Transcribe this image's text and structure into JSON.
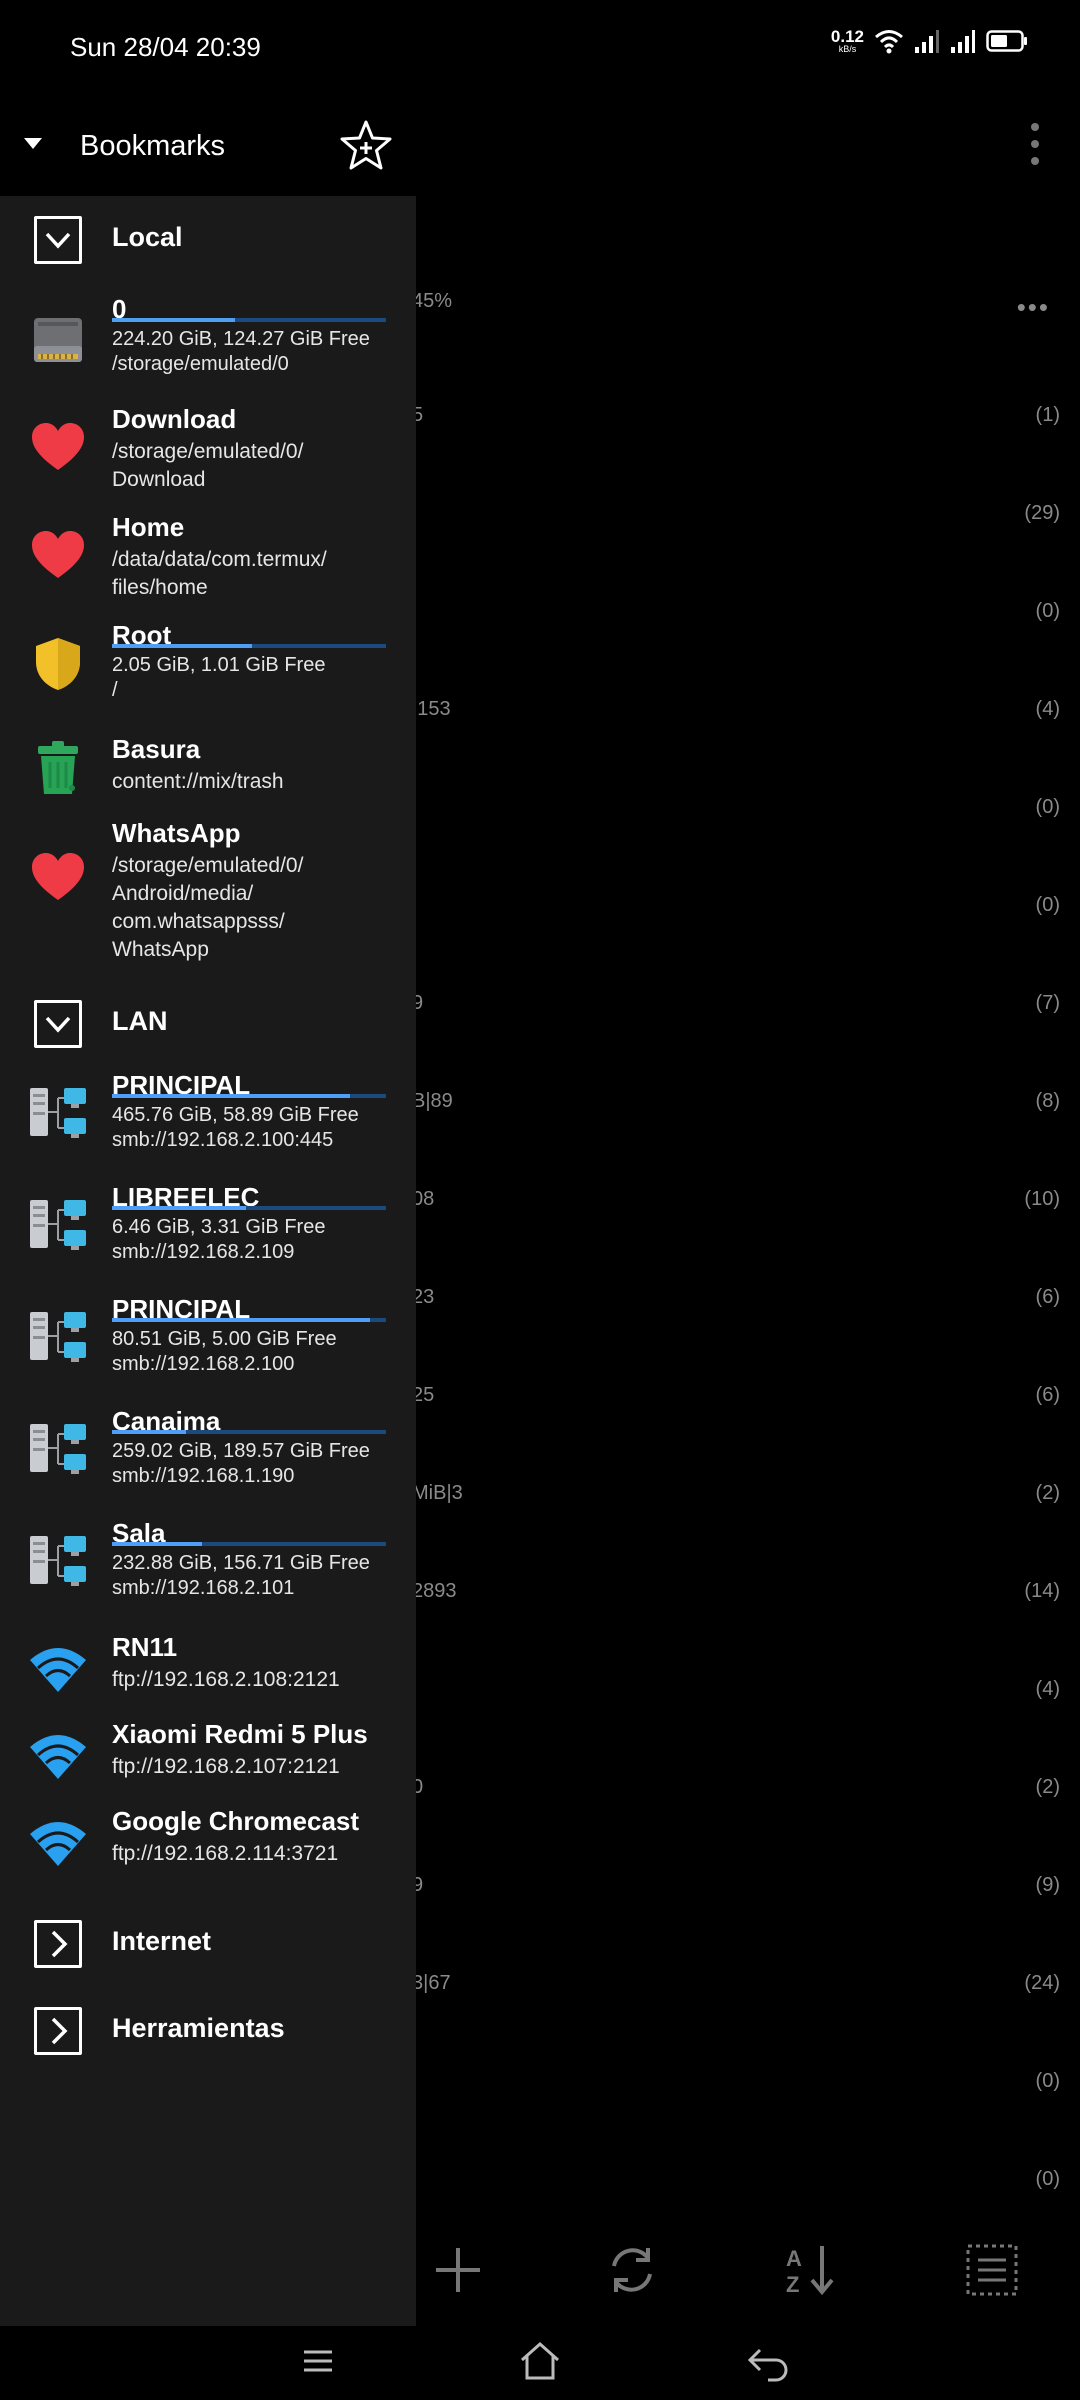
{
  "status": {
    "time": "Sun 28/04 20:39",
    "speed_value": "0.12",
    "speed_unit": "kB/s"
  },
  "drawer": {
    "title": "Bookmarks",
    "sections": [
      {
        "label": "Local",
        "state": "expanded"
      },
      {
        "label": "LAN",
        "state": "expanded"
      },
      {
        "label": "Internet",
        "state": "collapsed"
      },
      {
        "label": "Herramientas",
        "state": "collapsed"
      }
    ],
    "local_items": [
      {
        "icon": "drive-icon",
        "title": "0",
        "line1": "224.20 GiB,  124.27 GiB Free",
        "line2": "/storage/emulated/0",
        "used_fraction": 0.45
      },
      {
        "icon": "heart-icon",
        "title": "Download",
        "line1": "/storage/emulated/0/",
        "line2": "Download"
      },
      {
        "icon": "heart-icon",
        "title": "Home",
        "line1": "/data/data/com.termux/",
        "line2": "files/home"
      },
      {
        "icon": "shield-icon",
        "title": "Root",
        "line1": "2.05 GiB,  1.01 GiB Free",
        "line2": "/",
        "used_fraction": 0.51
      },
      {
        "icon": "trash-icon",
        "title": "Basura",
        "line1": "content://mix/trash"
      },
      {
        "icon": "heart-icon",
        "title": "WhatsApp",
        "line1": "/storage/emulated/0/",
        "line2": "Android/media/",
        "line3": "com.whatsappsss/",
        "line4": "WhatsApp"
      }
    ],
    "lan_items": [
      {
        "icon": "network-icon",
        "title": "PRINCIPAL",
        "line1": "465.76 GiB,  58.89 GiB Free",
        "line2": "smb://192.168.2.100:445",
        "used_fraction": 0.87
      },
      {
        "icon": "network-icon",
        "title": "LIBREELEC",
        "line1": "6.46 GiB,  3.31 GiB Free",
        "line2": "smb://192.168.2.109",
        "used_fraction": 0.49
      },
      {
        "icon": "network-icon",
        "title": "PRINCIPAL",
        "line1": "80.51 GiB,  5.00 GiB Free",
        "line2": "smb://192.168.2.100",
        "used_fraction": 0.94
      },
      {
        "icon": "network-icon",
        "title": "Canaima",
        "line1": "259.02 GiB,  189.57 GiB Free",
        "line2": "smb://192.168.1.190",
        "used_fraction": 0.27
      },
      {
        "icon": "network-icon",
        "title": "Sala",
        "line1": "232.88 GiB,  156.71 GiB Free",
        "line2": "smb://192.168.2.101",
        "used_fraction": 0.33
      },
      {
        "icon": "wifi-icon",
        "title": "RN11",
        "line1": "ftp://192.168.2.108:2121"
      },
      {
        "icon": "wifi-icon",
        "title": "Xiaomi Redmi 5 Plus",
        "line1": "ftp://192.168.2.107:2121"
      },
      {
        "icon": "wifi-icon",
        "title": "Google Chromecast",
        "line1": "ftp://192.168.2.114:3721"
      }
    ]
  },
  "background_list": [
    {
      "fragment": "45%",
      "count": ""
    },
    {
      "fragment": "5",
      "count": "(1)"
    },
    {
      "fragment": "",
      "count": "(29)"
    },
    {
      "fragment": "",
      "count": "(0)"
    },
    {
      "fragment": "|153",
      "count": "(4)"
    },
    {
      "fragment": "",
      "count": "(0)"
    },
    {
      "fragment": "",
      "count": "(0)"
    },
    {
      "fragment": "9",
      "count": "(7)"
    },
    {
      "fragment": "B|89",
      "count": "(8)"
    },
    {
      "fragment": "08",
      "count": "(10)"
    },
    {
      "fragment": "23",
      "count": "(6)"
    },
    {
      "fragment": "25",
      "count": "(6)"
    },
    {
      "fragment": "MiB|3",
      "count": "(2)"
    },
    {
      "fragment": "2893",
      "count": "(14)"
    },
    {
      "fragment": "",
      "count": "(4)"
    },
    {
      "fragment": "0",
      "count": "(2)"
    },
    {
      "fragment": "9",
      "count": "(9)"
    },
    {
      "fragment": "3|67",
      "count": "(24)"
    },
    {
      "fragment": "",
      "count": "(0)"
    },
    {
      "fragment": "",
      "count": "(0)"
    }
  ]
}
